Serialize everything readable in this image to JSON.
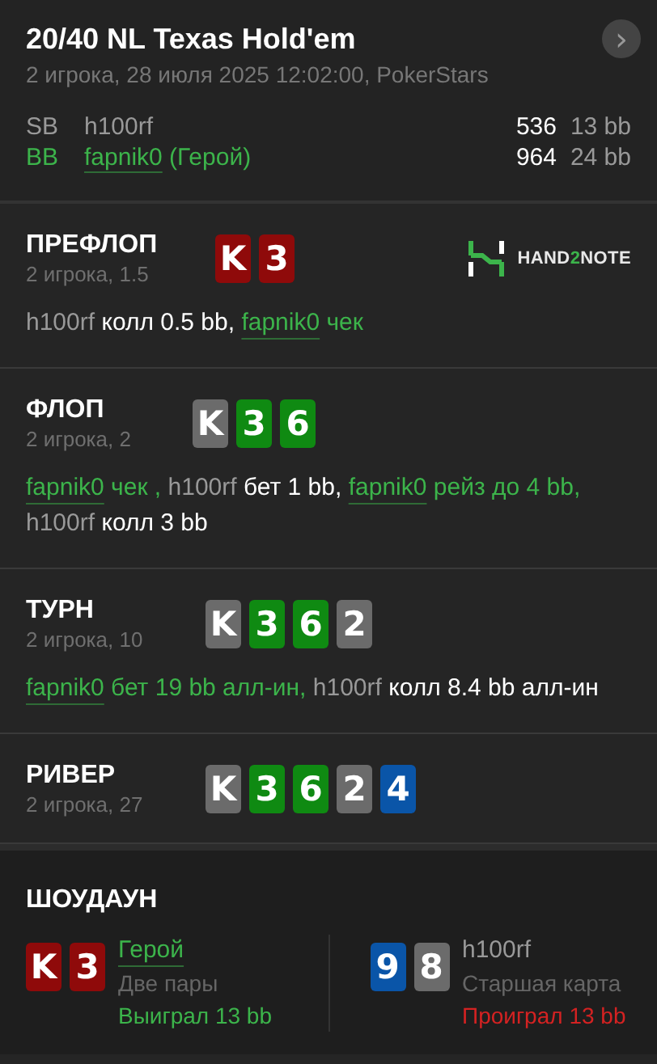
{
  "header": {
    "title": "20/40 NL Texas Hold'em",
    "subtitle": "2 игрока, 28 июля 2025 12:02:00, PokerStars",
    "next_button": "›"
  },
  "players": [
    {
      "position": "SB",
      "name": "h100rf",
      "hero": false,
      "stack": "536",
      "stack_bb": "13 bb"
    },
    {
      "position": "BB",
      "name": "fapnik0",
      "hero": true,
      "hero_tag": "(Герой)",
      "stack": "964",
      "stack_bb": "24 bb"
    }
  ],
  "logo": {
    "before": "HAND",
    "accent": "2",
    "after": "NOTE"
  },
  "streets": [
    {
      "name": "ПРЕФЛОП",
      "info": "2 игрока, 1.5",
      "cards": [
        {
          "rank": "K",
          "color": "#8f0a0a"
        },
        {
          "rank": "3",
          "color": "#8f0a0a"
        }
      ],
      "actions": [
        {
          "player": "h100rf",
          "hero": false,
          "action": "колл 0.5 bb,"
        },
        {
          "player": "fapnik0",
          "hero": true,
          "action": "чек"
        }
      ]
    },
    {
      "name": "ФЛОП",
      "info": "2 игрока, 2",
      "cards": [
        {
          "rank": "K",
          "color": "#6b6b6b"
        },
        {
          "rank": "3",
          "color": "#0f8a12"
        },
        {
          "rank": "6",
          "color": "#0f8a12"
        }
      ],
      "actions": [
        {
          "player": "fapnik0",
          "hero": true,
          "action": "чек ,"
        },
        {
          "player": "h100rf",
          "hero": false,
          "action": "бет 1 bb,"
        },
        {
          "player": "fapnik0",
          "hero": true,
          "action": "рейз до 4 bb,"
        },
        {
          "player": "h100rf",
          "hero": false,
          "action": "колл 3 bb"
        }
      ]
    },
    {
      "name": "ТУРН",
      "info": "2 игрока, 10",
      "cards": [
        {
          "rank": "K",
          "color": "#6b6b6b"
        },
        {
          "rank": "3",
          "color": "#0f8a12"
        },
        {
          "rank": "6",
          "color": "#0f8a12"
        },
        {
          "rank": "2",
          "color": "#6b6b6b"
        }
      ],
      "actions": [
        {
          "player": "fapnik0",
          "hero": true,
          "action": "бет 19 bb алл-ин,"
        },
        {
          "player": "h100rf",
          "hero": false,
          "action": "колл 8.4 bb алл-ин"
        }
      ]
    },
    {
      "name": "РИВЕР",
      "info": "2 игрока, 27",
      "cards": [
        {
          "rank": "K",
          "color": "#6b6b6b"
        },
        {
          "rank": "3",
          "color": "#0f8a12"
        },
        {
          "rank": "6",
          "color": "#0f8a12"
        },
        {
          "rank": "2",
          "color": "#6b6b6b"
        },
        {
          "rank": "4",
          "color": "#0a55a8"
        }
      ]
    }
  ],
  "showdown": {
    "title": "ШОУДАУН",
    "hands": [
      {
        "cards": [
          {
            "rank": "K",
            "color": "#8f0a0a"
          },
          {
            "rank": "3",
            "color": "#8f0a0a"
          }
        ],
        "name": "Герой",
        "hero": true,
        "hand": "Две пары",
        "result": "Выиграл 13 bb",
        "won": true
      },
      {
        "cards": [
          {
            "rank": "9",
            "color": "#0a55a8"
          },
          {
            "rank": "8",
            "color": "#6b6b6b"
          }
        ],
        "name": "h100rf",
        "hero": false,
        "hand": "Старшая карта",
        "result": "Проиграл 13 bb",
        "won": false
      }
    ]
  }
}
